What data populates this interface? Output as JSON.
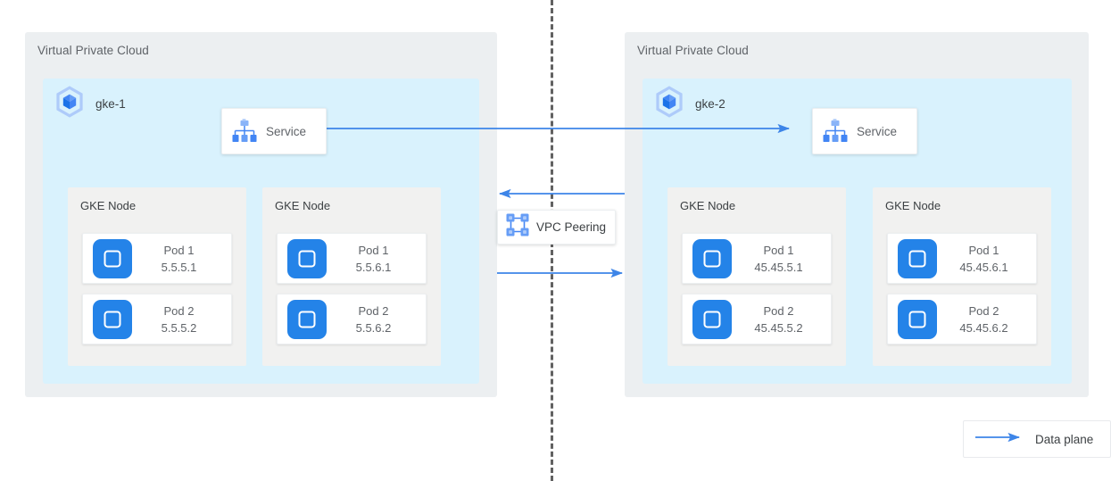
{
  "colors": {
    "arrow_blue": "#3d85e8",
    "vpc_fill": "#eceff1",
    "cluster_fill": "#d9f2fd",
    "node_fill": "#f1f1f0",
    "pod_blue": "#2483e8",
    "icon_blue_light": "#8ab4f8",
    "icon_blue": "#4285f4",
    "divider_gray": "#616161",
    "text_gray": "#5f6368"
  },
  "divider": {
    "style": "dashed",
    "orientation": "vertical"
  },
  "vpcs": [
    {
      "label": "Virtual Private Cloud",
      "cluster": {
        "name": "gke-1",
        "icon": "gke-cluster-icon",
        "service": {
          "label": "Service",
          "icon": "service-hierarchy-icon"
        },
        "nodes": [
          {
            "label": "GKE Node",
            "pods": [
              {
                "title": "Pod 1",
                "ip": "5.5.5.1",
                "icon": "pod-icon"
              },
              {
                "title": "Pod 2",
                "ip": "5.5.5.2",
                "icon": "pod-icon"
              }
            ]
          },
          {
            "label": "GKE Node",
            "pods": [
              {
                "title": "Pod 1",
                "ip": "5.5.6.1",
                "icon": "pod-icon"
              },
              {
                "title": "Pod 2",
                "ip": "5.5.6.2",
                "icon": "pod-icon"
              }
            ]
          }
        ]
      }
    },
    {
      "label": "Virtual Private Cloud",
      "cluster": {
        "name": "gke-2",
        "icon": "gke-cluster-icon",
        "service": {
          "label": "Service",
          "icon": "service-hierarchy-icon"
        },
        "nodes": [
          {
            "label": "GKE Node",
            "pods": [
              {
                "title": "Pod 1",
                "ip": "45.45.5.1",
                "icon": "pod-icon"
              },
              {
                "title": "Pod 2",
                "ip": "45.45.5.2",
                "icon": "pod-icon"
              }
            ]
          },
          {
            "label": "GKE Node",
            "pods": [
              {
                "title": "Pod 1",
                "ip": "45.45.6.1",
                "icon": "pod-icon"
              },
              {
                "title": "Pod 2",
                "ip": "45.45.6.2",
                "icon": "pod-icon"
              }
            ]
          }
        ]
      }
    }
  ],
  "peering": {
    "label": "VPC Peering",
    "icon": "vpc-peering-icon"
  },
  "legend": {
    "label": "Data plane",
    "icon": "arrow-right-icon"
  },
  "connections": [
    {
      "name": "service-to-service",
      "direction": "bidirectional"
    },
    {
      "name": "peering-inbound",
      "direction": "left"
    },
    {
      "name": "peering-outbound",
      "direction": "right"
    }
  ]
}
